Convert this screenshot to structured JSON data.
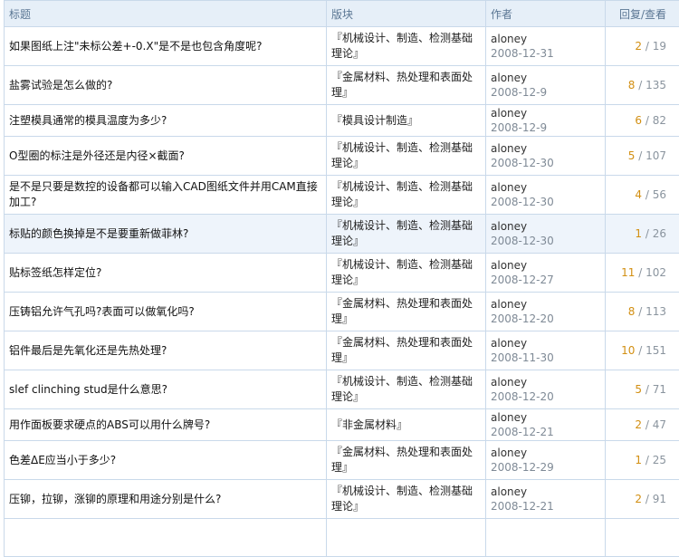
{
  "header": {
    "title": "标题",
    "board": "版块",
    "author": "作者",
    "stats": "回复/查看"
  },
  "rows": [
    {
      "title": "如果图纸上注\"未标公差+-0.X\"是不是也包含角度呢?",
      "board": "『机械设计、制造、检测基础理论』",
      "author": "aloney",
      "date": "2008-12-31",
      "replies": "2",
      "views": "19"
    },
    {
      "title": "盐雾试验是怎么做的?",
      "board": "『金属材料、热处理和表面处理』",
      "author": "aloney",
      "date": "2008-12-9",
      "replies": "8",
      "views": "135"
    },
    {
      "title": "注塑模具通常的模具温度为多少?",
      "board": "『模具设计制造』",
      "author": "aloney",
      "date": "2008-12-9",
      "replies": "6",
      "views": "82"
    },
    {
      "title": "O型圈的标注是外径还是内径×截面?",
      "board": "『机械设计、制造、检测基础理论』",
      "author": "aloney",
      "date": "2008-12-30",
      "replies": "5",
      "views": "107"
    },
    {
      "title": "是不是只要是数控的设备都可以输入CAD图纸文件并用CAM直接加工?",
      "board": "『机械设计、制造、检测基础理论』",
      "author": "aloney",
      "date": "2008-12-30",
      "replies": "4",
      "views": "56"
    },
    {
      "title": "标贴的颜色换掉是不是要重新做菲林?",
      "board": "『机械设计、制造、检测基础理论』",
      "author": "aloney",
      "date": "2008-12-30",
      "replies": "1",
      "views": "26"
    },
    {
      "title": "贴标签纸怎样定位?",
      "board": "『机械设计、制造、检测基础理论』",
      "author": "aloney",
      "date": "2008-12-27",
      "replies": "11",
      "views": "102"
    },
    {
      "title": "压铸铝允许气孔吗?表面可以做氧化吗?",
      "board": "『金属材料、热处理和表面处理』",
      "author": "aloney",
      "date": "2008-12-20",
      "replies": "8",
      "views": "113"
    },
    {
      "title": "铝件最后是先氧化还是先热处理?",
      "board": "『金属材料、热处理和表面处理』",
      "author": "aloney",
      "date": "2008-11-30",
      "replies": "10",
      "views": "151"
    },
    {
      "title": "slef clinching stud是什么意思?",
      "board": "『机械设计、制造、检测基础理论』",
      "author": "aloney",
      "date": "2008-12-20",
      "replies": "5",
      "views": "71"
    },
    {
      "title": "用作面板要求硬点的ABS可以用什么牌号?",
      "board": "『非金属材料』",
      "author": "aloney",
      "date": "2008-12-21",
      "replies": "2",
      "views": "47"
    },
    {
      "title": "色差ΔE应当小于多少?",
      "board": "『金属材料、热处理和表面处理』",
      "author": "aloney",
      "date": "2008-12-29",
      "replies": "1",
      "views": "25"
    },
    {
      "title": "压铆，拉铆，涨铆的原理和用途分别是什么?",
      "board": "『机械设计、制造、检测基础理论』",
      "author": "aloney",
      "date": "2008-12-21",
      "replies": "2",
      "views": "91"
    }
  ]
}
